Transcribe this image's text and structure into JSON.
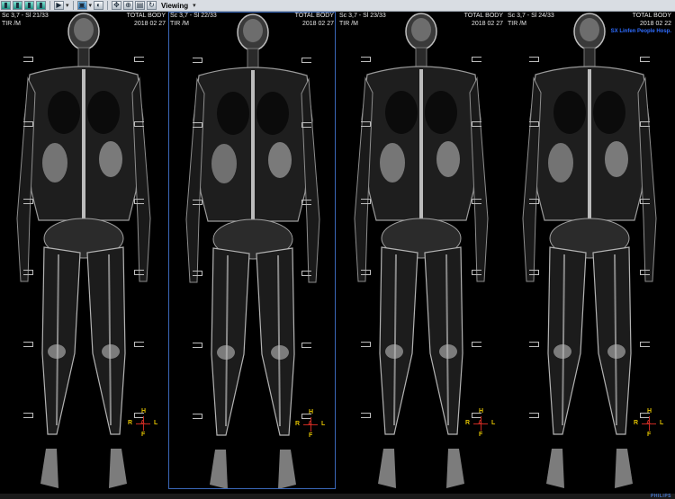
{
  "toolbar": {
    "mode_label": "Viewing",
    "icons": [
      "layout-1-icon",
      "layout-2-icon",
      "layout-3-icon",
      "layout-4-icon",
      "play-icon",
      "display-icon",
      "contrast-icon",
      "move-icon",
      "zoom-icon",
      "clipboard-icon",
      "rotate-icon"
    ]
  },
  "viewports": [
    {
      "series": "Sc 3,7 - Sl 21/33",
      "protocol": "TIR  /M",
      "title": "TOTAL BODY",
      "date": "2018 02 27",
      "active": false,
      "hospital": ""
    },
    {
      "series": "Sc 3,7 - Sl 22/33",
      "protocol": "TIR  /M",
      "title": "TOTAL BODY",
      "date": "2018 02 27",
      "active": true,
      "hospital": ""
    },
    {
      "series": "Sc 3,7 - Sl 23/33",
      "protocol": "TIR  /M",
      "title": "TOTAL BODY",
      "date": "2018 02 27",
      "active": false,
      "hospital": ""
    },
    {
      "series": "Sc 3,7 - Sl 24/33",
      "protocol": "TIR  /M",
      "title": "TOTAL BODY",
      "date": "2018 02 22",
      "active": false,
      "hospital": "SX Linfen People Hosp."
    }
  ],
  "orientation": {
    "top": "H",
    "bottom": "F",
    "left": "R",
    "right": "L",
    "center": "A"
  },
  "colors": {
    "active_border": "#3a67b8",
    "orientation_red": "#c82a22",
    "orientation_yellow": "#e0c000",
    "hospital_blue": "#2f6dff"
  },
  "status": {
    "vendor": "PHILIPS"
  }
}
